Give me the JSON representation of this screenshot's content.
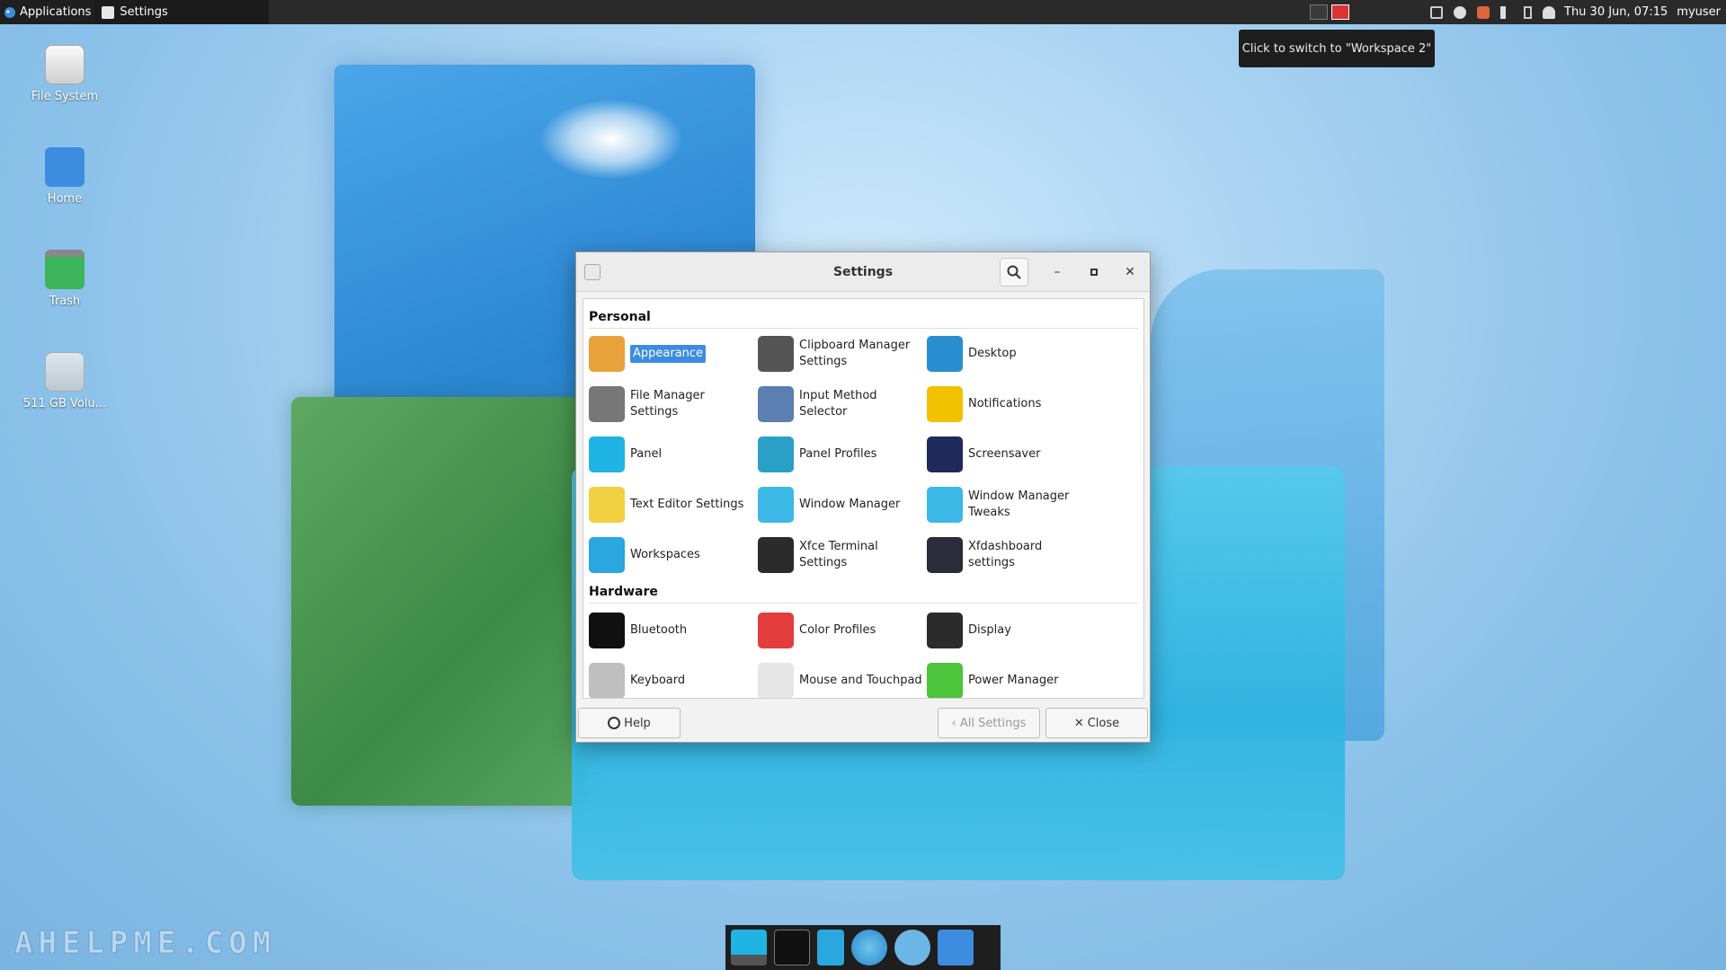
{
  "top_panel": {
    "applications_label": "Applications",
    "active_window": "Settings",
    "clock": "Thu 30 Jun, 07:15",
    "user": "myuser",
    "tooltip": "Click to switch to \"Workspace 2\""
  },
  "desktop_icons": [
    {
      "label": "File System",
      "icon": "drive-icon"
    },
    {
      "label": "Home",
      "icon": "home-folder-icon"
    },
    {
      "label": "Trash",
      "icon": "trash-icon"
    },
    {
      "label": "511 GB Volu...",
      "icon": "volume-icon"
    }
  ],
  "window": {
    "title": "Settings",
    "sections": [
      {
        "name": "Personal",
        "items": [
          {
            "label": "Appearance",
            "icon": "appearance-icon",
            "color": "#e9a23b",
            "selected": true
          },
          {
            "label": "Clipboard Manager Settings",
            "icon": "clipboard-icon",
            "color": "#555555"
          },
          {
            "label": "Desktop",
            "icon": "desktop-icon",
            "color": "#2a8fd0"
          },
          {
            "label": "File Manager Settings",
            "icon": "file-manager-icon",
            "color": "#777777"
          },
          {
            "label": "Input Method Selector",
            "icon": "input-method-icon",
            "color": "#5a7fb0"
          },
          {
            "label": "Notifications",
            "icon": "bell-icon",
            "color": "#f2c200"
          },
          {
            "label": "Panel",
            "icon": "panel-icon",
            "color": "#1fb4e3"
          },
          {
            "label": "Panel Profiles",
            "icon": "panel-profiles-icon",
            "color": "#2aa0c8"
          },
          {
            "label": "Screensaver",
            "icon": "screensaver-icon",
            "color": "#1d2a5a"
          },
          {
            "label": "Text Editor Settings",
            "icon": "text-editor-icon",
            "color": "#f0d040"
          },
          {
            "label": "Window Manager",
            "icon": "window-manager-icon",
            "color": "#3cb8e6"
          },
          {
            "label": "Window Manager Tweaks",
            "icon": "window-tweaks-icon",
            "color": "#3cb8e6"
          },
          {
            "label": "Workspaces",
            "icon": "workspaces-icon",
            "color": "#2aa7df"
          },
          {
            "label": "Xfce Terminal Settings",
            "icon": "terminal-icon",
            "color": "#2b2b2b"
          },
          {
            "label": "Xfdashboard settings",
            "icon": "dashboard-icon",
            "color": "#2b2b3b"
          }
        ]
      },
      {
        "name": "Hardware",
        "items": [
          {
            "label": "Bluetooth",
            "icon": "bluetooth-icon",
            "color": "#111111"
          },
          {
            "label": "Color Profiles",
            "icon": "color-profiles-icon",
            "color": "#e33c3c"
          },
          {
            "label": "Display",
            "icon": "display-icon",
            "color": "#2b2b2b"
          },
          {
            "label": "Keyboard",
            "icon": "keyboard-icon",
            "color": "#bfbfbf"
          },
          {
            "label": "Mouse and Touchpad",
            "icon": "mouse-icon",
            "color": "#e6e6e6"
          },
          {
            "label": "Power Manager",
            "icon": "battery-icon",
            "color": "#4cc43c"
          }
        ]
      }
    ],
    "footer": {
      "help": "Help",
      "all_settings": "All Settings",
      "close": "Close"
    }
  },
  "watermark": "AHELPME.COM"
}
